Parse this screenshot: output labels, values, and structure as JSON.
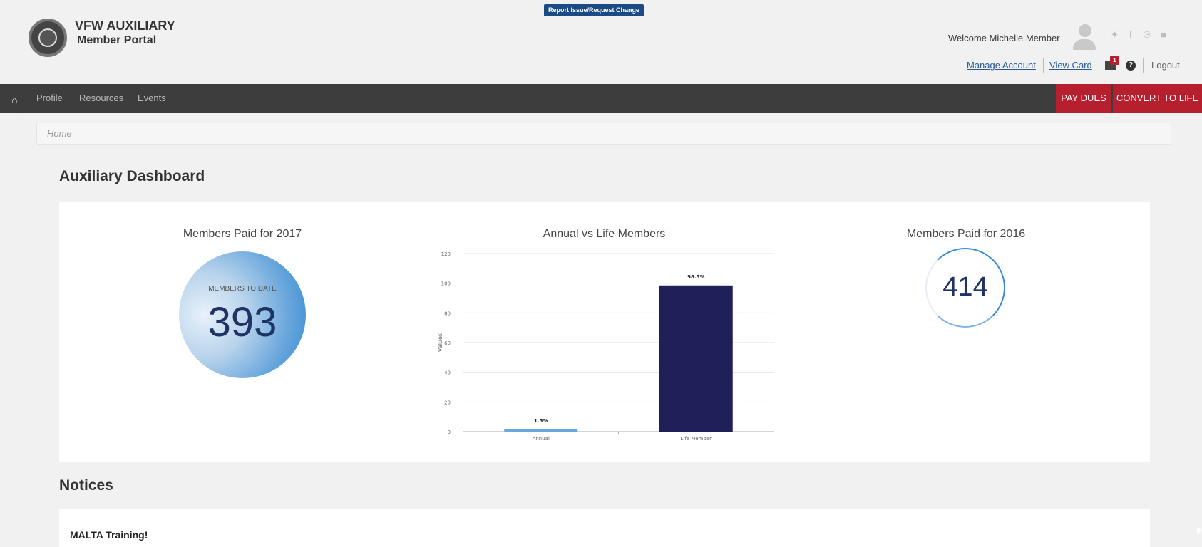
{
  "header": {
    "brand_line1": "VFW AUXILIARY",
    "brand_line2": "Member Portal",
    "report_button": "Report Issue/Request Change",
    "welcome": "Welcome Michelle Member",
    "social_icons": [
      "twitter-icon",
      "facebook-icon",
      "pinterest-icon",
      "youtube-icon"
    ],
    "manage_account": "Manage Account",
    "view_card": "View Card",
    "mail_badge_count": "1",
    "logout": "Logout"
  },
  "nav": {
    "items": [
      "Profile",
      "Resources",
      "Events"
    ],
    "pay_dues": "PAY DUES",
    "convert_to_life": "CONVERT TO LIFE"
  },
  "breadcrumb": {
    "current": "Home"
  },
  "dashboard": {
    "title": "Auxiliary Dashboard",
    "paid_2017": {
      "title": "Members Paid for 2017",
      "label": "MEMBERS TO DATE",
      "value": "393"
    },
    "annual_vs_life_title": "Annual vs Life Members",
    "paid_2016": {
      "title": "Members Paid for 2016",
      "value": "414"
    }
  },
  "notices": {
    "title": "Notices",
    "items": [
      "MALTA Training!"
    ]
  },
  "colors": {
    "nav_bg": "#3d3d3d",
    "accent_red": "#b51f2e",
    "life_bar": "#1f1f5a",
    "annual_bar": "#6aa7dc",
    "number_text": "#203366"
  },
  "chart_data": {
    "type": "bar",
    "title": "Annual vs Life Members",
    "categories": [
      "Annual",
      "Life Member"
    ],
    "values": [
      1.5,
      98.5
    ],
    "data_labels": [
      "1.5%",
      "98.5%"
    ],
    "bar_colors": [
      "#6aa7dc",
      "#1f1f5a"
    ],
    "ylabel": "Values",
    "xlabel": "",
    "ylim": [
      0,
      120
    ],
    "yticks": [
      0,
      20,
      40,
      60,
      80,
      100,
      120
    ],
    "grid": true,
    "legend": "none"
  }
}
